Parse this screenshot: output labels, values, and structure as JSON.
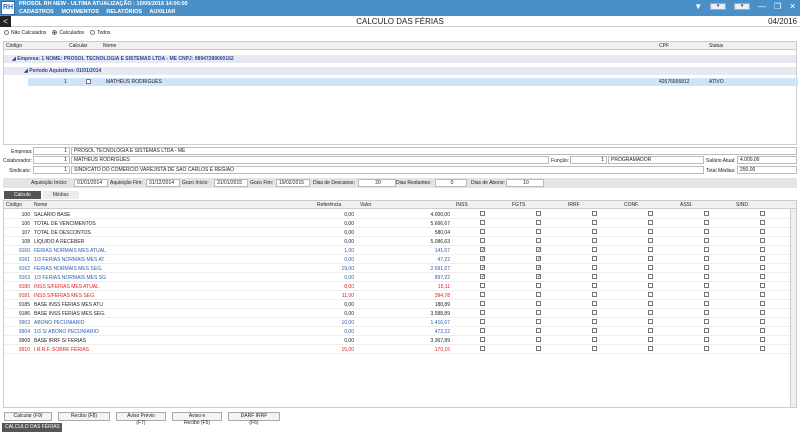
{
  "app": {
    "title": "PROSOL RH NEW - ULTIMA ATUALIZAÇÃO : 10/05/2016 14:00:00",
    "menu": [
      "CADASTROS",
      "MOVIMENTOS",
      "RELATÓRIOS",
      "AUXILIAR"
    ]
  },
  "header": {
    "back": "<",
    "title": "CALCULO DAS FÉRIAS",
    "period": "04/2016"
  },
  "filters": {
    "not_calc": "Não Calculados",
    "calc": "Calculados",
    "all": "Todos"
  },
  "top_grid": {
    "headers": {
      "codigo": "Código",
      "calcular": "Calcular",
      "nome": "Nome",
      "cpf": "CPF",
      "status": "Status"
    },
    "group1": "Empresa: 1 NOME: PROSOL TECNOLOGIA E SISTEMAS LTDA - ME  CNPJ: 08947289000162",
    "group2": "Periodo Aquisitivo: 01/01/2014",
    "row": {
      "codigo": "1",
      "nome": "MATHEUS RODRIGUES",
      "cpf": "42676656812",
      "status": "ATIVO"
    }
  },
  "form": {
    "empresa_label": "Empresa:",
    "empresa_code": "1",
    "empresa_name": "PROSOL TECNOLOGIA E SISTEMAS LTDA - ME",
    "colab_label": "Colaborador:",
    "colab_code": "1",
    "colab_name": "MATHEUS RODRIGUES",
    "sind_label": "Sindicato:",
    "sind_code": "1",
    "sind_name": "SINDICATO DO COMERCIO VAREJISTA DE SAO CARLOS E REGIAO",
    "funcao_label": "Função:",
    "funcao_code": "1",
    "funcao_name": "PROGRAMADOR",
    "salario_label": "Salário Atual:",
    "salario": "4.000,00",
    "medias_label": "Total Médias:",
    "medias": "250,00"
  },
  "dates": {
    "aq_ini_l": "Aquisição Início:",
    "aq_ini": "01/01/2014",
    "aq_fim_l": "Aquisição Fim:",
    "aq_fim": "31/12/2014",
    "gz_ini_l": "Gozo Início:",
    "gz_ini": "31/01/2015",
    "gz_fim_l": "Gozo Fim:",
    "gz_fim": "19/02/2015",
    "desc_l": "Dias de Descanso:",
    "desc": "20",
    "rest_l": "Dias Restantes:",
    "rest": "0",
    "abono_l": "Dias de Abono:",
    "abono": "10"
  },
  "tabs": [
    "Calculo",
    "Médias"
  ],
  "grid_headers": {
    "codigo": "Código",
    "nome": "Nome",
    "ref": "Referência",
    "valor": "Valor",
    "inss": "INSS",
    "fgts": "FGTS",
    "irrf": "IRRF",
    "conf": "CONF.",
    "assi": "ASSI.",
    "sind": "SIND."
  },
  "rows": [
    {
      "c": "100",
      "n": "SALARIO BASE",
      "r": "0,00",
      "v": "4.000,00",
      "k": "",
      "i": 0,
      "f": 0
    },
    {
      "c": "106",
      "n": "TOTAL DE VENCIMENTOS",
      "r": "0,00",
      "v": "5.666,67",
      "k": "",
      "i": 0,
      "f": 0
    },
    {
      "c": "107",
      "n": "TOTAL DE DESCONTOS",
      "r": "0,00",
      "v": "580,04",
      "k": "",
      "i": 0,
      "f": 0
    },
    {
      "c": "108",
      "n": "LIQUIDO A RECEBER",
      "r": "0,00",
      "v": "5.086,63",
      "k": "",
      "i": 0,
      "f": 0
    },
    {
      "c": "9160",
      "n": "FERIAS NORMAIS MES ATUAL",
      "r": "1,00",
      "v": "141,67",
      "k": "blue",
      "i": 1,
      "f": 1
    },
    {
      "c": "9161",
      "n": "1/3 FERIAS NORMAIS MES AT",
      "r": "0,00",
      "v": "47,22",
      "k": "blue",
      "i": 1,
      "f": 1
    },
    {
      "c": "9162",
      "n": "FERIAS NORMAIS MES SEG.",
      "r": "19,00",
      "v": "2.691,67",
      "k": "blue",
      "i": 1,
      "f": 1
    },
    {
      "c": "9163",
      "n": "1/3 FERIAS NORMAIS MES SG",
      "r": "0,00",
      "v": "897,22",
      "k": "blue",
      "i": 1,
      "f": 1
    },
    {
      "c": "9180",
      "n": "INSS S/FERIAS MES ATUAL",
      "r": "8,00",
      "v": "15,11",
      "k": "red",
      "i": 0,
      "f": 0
    },
    {
      "c": "9181",
      "n": "INSS S/FERIAS MES SEG.",
      "r": "11,00",
      "v": "394,78",
      "k": "red",
      "i": 0,
      "f": 0
    },
    {
      "c": "9185",
      "n": "BASE INSS FERIAS MES ATU",
      "r": "0,00",
      "v": "188,89",
      "k": "",
      "i": 0,
      "f": 0
    },
    {
      "c": "9186",
      "n": "BASE INSS FERIAS MES SEG.",
      "r": "0,00",
      "v": "3.588,89",
      "k": "",
      "i": 0,
      "f": 0
    },
    {
      "c": "9903",
      "n": "ABONO PECUNIARIO",
      "r": "10,00",
      "v": "1.416,67",
      "k": "blue",
      "i": 0,
      "f": 0
    },
    {
      "c": "9904",
      "n": "1/3 S/ ABONO PECUNIARIO",
      "r": "0,00",
      "v": "472,22",
      "k": "blue",
      "i": 0,
      "f": 0
    },
    {
      "c": "9909",
      "n": "BASE IRRF S/ FERIAS",
      "r": "0,00",
      "v": "3.367,89",
      "k": "",
      "i": 0,
      "f": 0
    },
    {
      "c": "9910",
      "n": "I.R.R.F. SOBRE FERIAS",
      "r": "15,00",
      "v": "170,15",
      "k": "red",
      "i": 0,
      "f": 0
    }
  ],
  "buttons": [
    "Calcular (F9)",
    "Recibo (F8)",
    "Aviso Prévio (F7)",
    "Aviso e Recibo (F5)",
    "DARF IRRF (F6)"
  ],
  "status": "CALCULO DAS FÉRIAS",
  "colors": {
    "titlebar": "#4a90c8",
    "selected": "#cfe4f7",
    "blue": "#2a5db0",
    "red": "#dd2222"
  }
}
